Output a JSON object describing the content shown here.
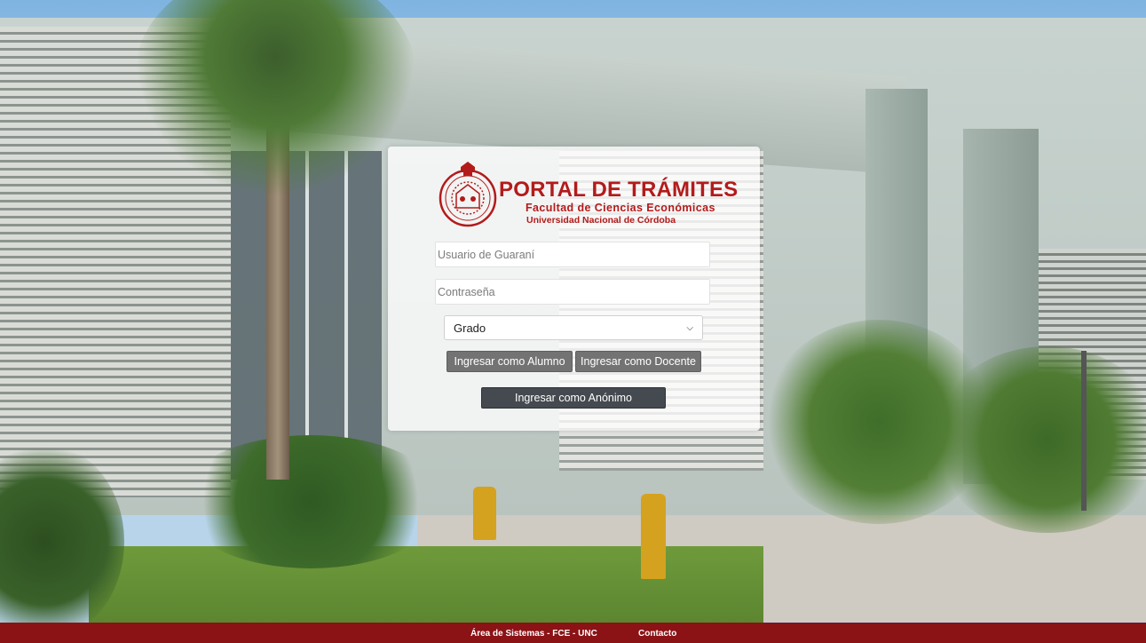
{
  "brand": {
    "title": "PORTAL DE TRÁMITES",
    "subtitle": "Facultad de Ciencias Económicas",
    "institution": "Universidad Nacional de Córdoba",
    "seal_icon": "university-seal-icon",
    "color": "#b31b1b"
  },
  "login": {
    "user_placeholder": "Usuario de Guaraní",
    "password_placeholder": "Contraseña",
    "level_select": {
      "selected": "Grado"
    },
    "buttons": {
      "student": "Ingresar como Alumno",
      "teacher": "Ingresar como Docente",
      "anonymous": "Ingresar como Anónimo"
    }
  },
  "footer": {
    "left": "Área de Sistemas - FCE - UNC",
    "right": "Contacto",
    "color": "#8b1215"
  }
}
